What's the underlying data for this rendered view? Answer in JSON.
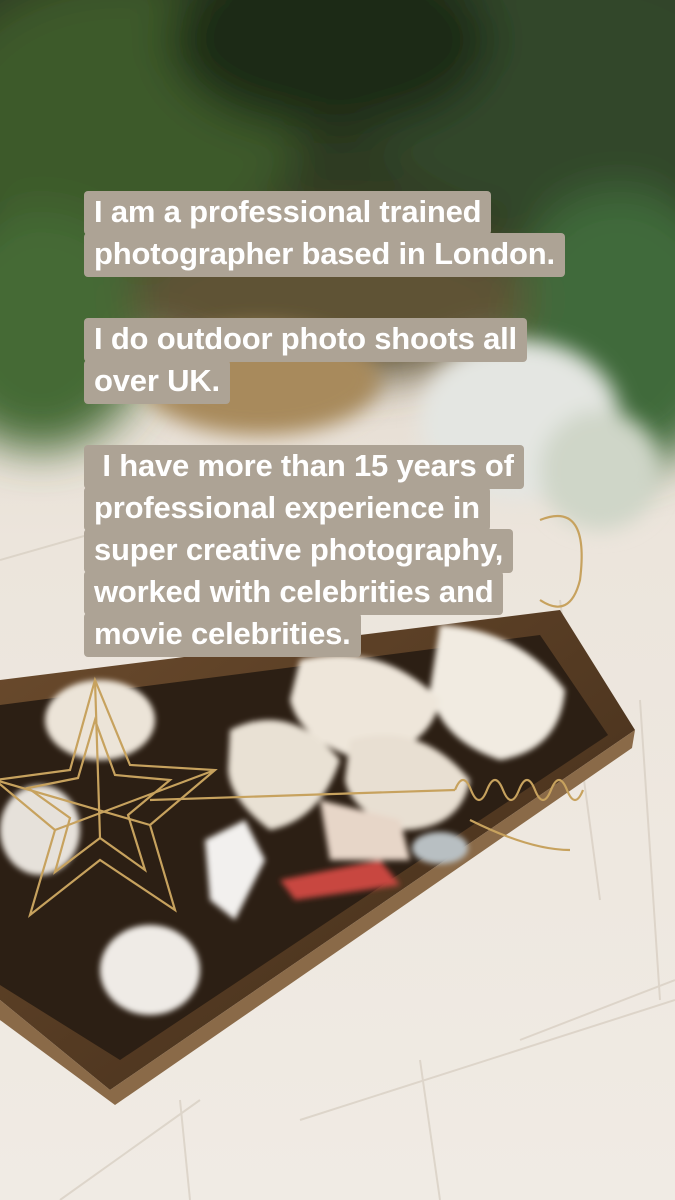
{
  "story": {
    "captions": [
      {
        "lines": [
          "I am a professional trained",
          "photographer based in London."
        ]
      },
      {
        "lines": [
          "I do outdoor photo shoots all",
          "over UK."
        ]
      },
      {
        "lines": [
          " I have more than 15 years of",
          "professional experience in",
          "super creative photography,",
          "worked with celebrities and",
          "movie celebrities."
        ]
      }
    ],
    "colors": {
      "caption_background": "#ada395",
      "caption_text": "#ffffff",
      "floor": "#e9e2d9",
      "foliage": "#2f3d25",
      "crate_wood": "#5a3e26",
      "gold_wire": "#c7a25e"
    }
  }
}
